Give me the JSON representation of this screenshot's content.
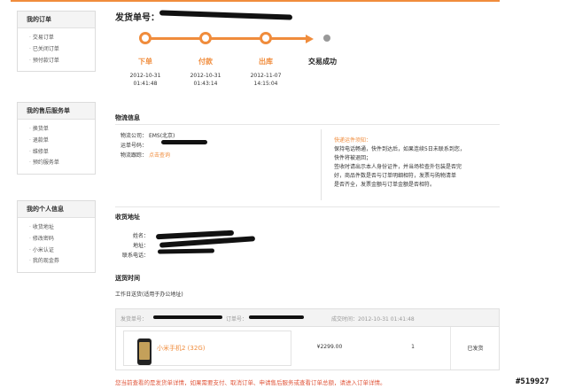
{
  "sidebar": {
    "groups": [
      {
        "title": "我的订单",
        "items": [
          "交易订单",
          "已关闭订单",
          "预付款订单"
        ]
      },
      {
        "title": "我的售后服务单",
        "items": [
          "换货单",
          "退款单",
          "维修单",
          "预约服务单"
        ]
      },
      {
        "title": "我的个人信息",
        "items": [
          "收货地址",
          "修改密码",
          "小米认证",
          "我的现金券"
        ]
      }
    ]
  },
  "order": {
    "title": "发货单号："
  },
  "progress": {
    "steps": [
      {
        "label": "下单",
        "date": "2012-10-31",
        "time": "01:41:48"
      },
      {
        "label": "付款",
        "date": "2012-10-31",
        "time": "01:43:14"
      },
      {
        "label": "出库",
        "date": "2012-11-07",
        "time": "14:15:04"
      }
    ],
    "final_label": "交易成功"
  },
  "logistics": {
    "title": "物流信息",
    "company_label": "物流公司：",
    "company_value": "EMS(北京)",
    "tracking_label": "运单号码：",
    "trace_label": "物流跟踪：",
    "trace_link": "点击查询"
  },
  "tips": {
    "title": "快递运件须知：",
    "lines": [
      "保持电话畅通，快件到达后，如果连续5日未联系到您，",
      "快件将被退回；",
      "签收时请出示本人身份证件，并当场检查外包装是否完",
      "好，商品件数是否与订单明细相符，发票与购物清单",
      "是否齐全，发票金额与订单金额是否相符。"
    ]
  },
  "address": {
    "title": "收货地址",
    "name_label": "姓名：",
    "addr_label": "地址：",
    "phone_label": "联系电话："
  },
  "delivery": {
    "title": "送货时间",
    "value": "工作日送货(适用于办公地址)"
  },
  "table": {
    "header_ship": "发货单号：",
    "header_order": "订单号：",
    "header_time": "成交时间：2012-10-31 01:41:48",
    "product_name": "小米手机2 (32G)",
    "price": "¥2299.00",
    "qty": "1",
    "status": "已发货"
  },
  "notice": "您当前查看的是发货单详情，如果需要支付、取消订单、申请售后服务或查看订单总额，请进入订单详情。",
  "watermark": "#519927"
}
